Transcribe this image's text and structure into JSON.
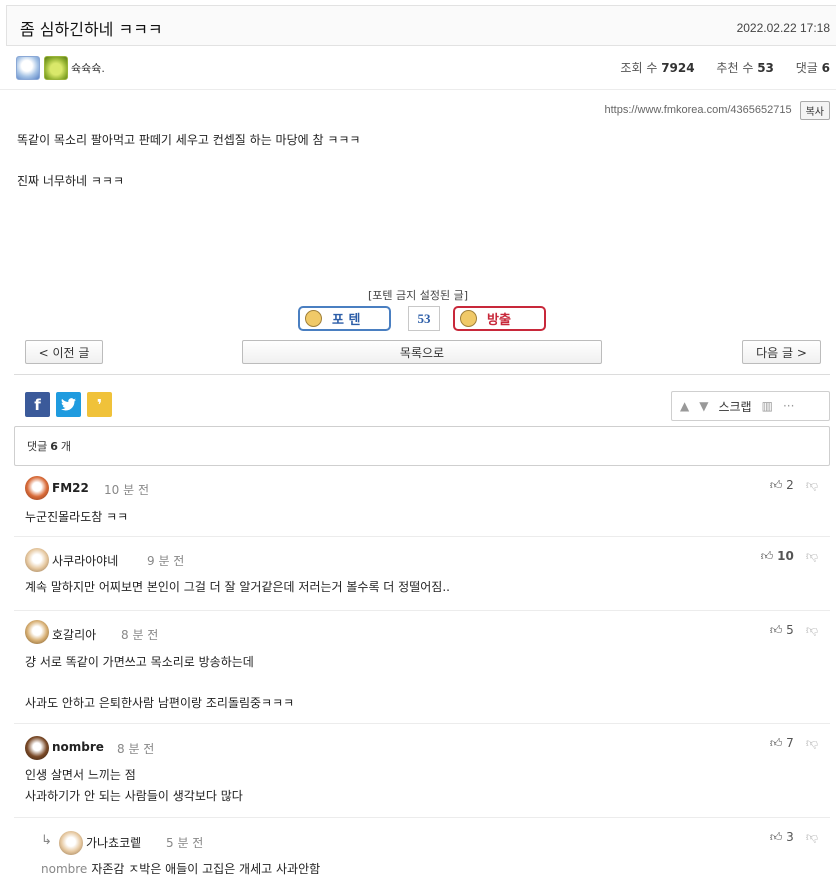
{
  "post": {
    "title": "좀 심하긴하네 ㅋㅋㅋ",
    "date": "2022.02.22 17:18",
    "author": "슉슉슉.",
    "views_label": "조회 수",
    "views": "7924",
    "likes_label": "추천 수",
    "likes": "53",
    "comments_label": "댓글",
    "comments": "6",
    "url": "https://www.fmkorea.com/4365652715",
    "copy_label": "복사",
    "body": [
      "똑같이 목소리 팔아먹고 판떼기 세우고 컨셉질 하는 마당에 참 ㅋㅋㅋ",
      "진짜 너무하네 ㅋㅋㅋ"
    ],
    "notice": "[포텐 금지 설정된 글]",
    "vote_up_label": "포 텐",
    "vote_count": "53",
    "vote_down_label": "방출"
  },
  "nav": {
    "prev": "< 이전 글",
    "list": "목록으로",
    "next": "다음 글 >"
  },
  "tools": {
    "scrap": "스크랩"
  },
  "comment_summary": {
    "prefix": "댓글",
    "count": "6",
    "suffix": "개"
  },
  "comments": [
    {
      "name": "FM22",
      "time": "10 분 전",
      "body": [
        "누군진몰라도참 ㅋㅋ"
      ],
      "votes": "2"
    },
    {
      "name": "사쿠라아야네",
      "time": "9 분 전",
      "body": [
        "계속 말하지만 어찌보면 본인이 그걸 더 잘 알거같은데 저러는거 볼수록 더 정떨어짐.."
      ],
      "votes": "10"
    },
    {
      "name": "호갈리아",
      "time": "8 분 전",
      "body": [
        "걍 서로 똑같이 가면쓰고 목소리로 방송하는데",
        "",
        "사과도 안하고 은퇴한사람 남편이랑 조리돌림중ㅋㅋㅋ"
      ],
      "votes": "5"
    },
    {
      "name": "nombre",
      "time": "8 분 전",
      "body": [
        "인생 살면서 느끼는 점",
        "사과하기가 안 되는 사람들이 생각보다 많다"
      ],
      "votes": "7"
    },
    {
      "name": "가나쵸코렡",
      "time": "5 분 전",
      "mention": "nombre",
      "body": [
        "자존감 ㅈ박은 애들이 고집은 개세고 사과안함"
      ],
      "votes": "3"
    }
  ]
}
